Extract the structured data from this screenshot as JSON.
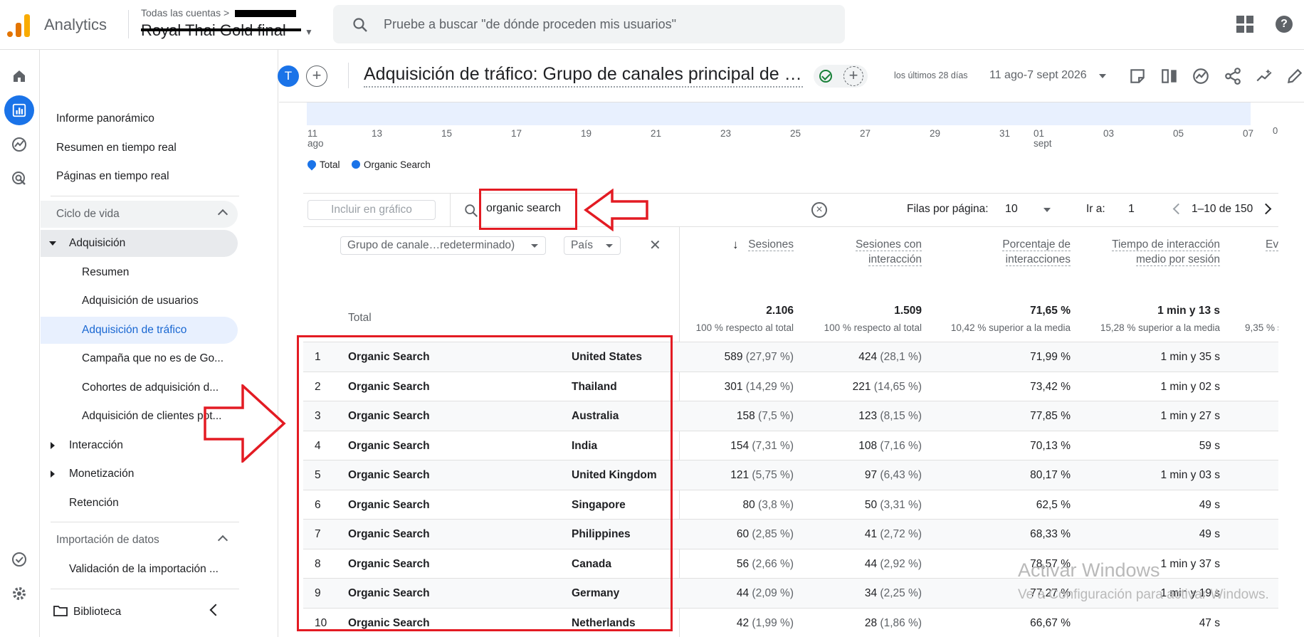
{
  "header": {
    "app_name": "Analytics",
    "accounts_label": "Todas las cuentas >",
    "property_name": "Royal Thai Gold final",
    "search_placeholder": "Pruebe a buscar \"de dónde proceden mis usuarios\""
  },
  "nav": {
    "items": [
      {
        "label": "Informe panorámico"
      },
      {
        "label": "Resumen en tiempo real"
      },
      {
        "label": "Páginas en tiempo real"
      },
      {
        "label": "Ciclo de vida"
      },
      {
        "label": "Adquisición"
      },
      {
        "label": "Resumen"
      },
      {
        "label": "Adquisición de usuarios"
      },
      {
        "label": "Adquisición de tráfico"
      },
      {
        "label": "Campaña que no es de Go..."
      },
      {
        "label": "Cohortes de adquisición d..."
      },
      {
        "label": "Adquisición de clientes pot..."
      },
      {
        "label": "Interacción"
      },
      {
        "label": "Monetización"
      },
      {
        "label": "Retención"
      },
      {
        "label": "Importación de datos"
      },
      {
        "label": "Validación de la importación ..."
      },
      {
        "label": "Biblioteca"
      }
    ]
  },
  "report": {
    "avatar_letter": "T",
    "title": "Adquisición de tráfico: Grupo de canales principal de la sesión (Grupo de canales predeterminado)",
    "date_label": "los últimos 28 días",
    "date_range": "11 ago-7 sept 2026"
  },
  "chart": {
    "x_ticks": [
      "11",
      "13",
      "15",
      "17",
      "19",
      "21",
      "23",
      "25",
      "27",
      "29",
      "31",
      "01",
      "03",
      "05",
      "07"
    ],
    "x_sub_ago": "ago",
    "x_sub_sept": "sept",
    "y_zero": "0",
    "legend": [
      {
        "label": "Total",
        "color": "#1a73e8"
      },
      {
        "label": "Organic Search",
        "color": "#1a73e8"
      }
    ]
  },
  "table_toolbar": {
    "chart_button": "Incluir en gráfico",
    "search_value": "organic search",
    "rows_per_page_label": "Filas por página:",
    "rows_per_page_value": "10",
    "goto_label": "Ir a:",
    "goto_value": "1",
    "page_range": "1–10 de 150"
  },
  "table": {
    "dimension_1": "Grupo de canale…redeterminado)",
    "dimension_2": "País",
    "total_label": "Total",
    "columns": [
      {
        "line1": "Sesiones",
        "line2": ""
      },
      {
        "line1": "Sesiones con",
        "line2": "interacción"
      },
      {
        "line1": "Porcentaje de",
        "line2": "interacciones"
      },
      {
        "line1": "Tiempo de interacción",
        "line2": "medio por sesión"
      },
      {
        "line1": "Ev",
        "line2": ""
      }
    ],
    "totals": [
      {
        "value": "2.106",
        "sub": "100 % respecto al total"
      },
      {
        "value": "1.509",
        "sub": "100 % respecto al total"
      },
      {
        "value": "71,65 %",
        "sub": "10,42 % superior a la media"
      },
      {
        "value": "1 min y 13 s",
        "sub": "15,28 % superior a la media"
      },
      {
        "value": "",
        "sub": "9,35 % s"
      }
    ],
    "rows": [
      {
        "idx": "1",
        "channel": "Organic Search",
        "country": "United States",
        "sessions": "589",
        "sessions_pct": "(27,97 %)",
        "engaged": "424",
        "engaged_pct": "(28,1 %)",
        "rate": "71,99 %",
        "time": "1 min y 35 s"
      },
      {
        "idx": "2",
        "channel": "Organic Search",
        "country": "Thailand",
        "sessions": "301",
        "sessions_pct": "(14,29 %)",
        "engaged": "221",
        "engaged_pct": "(14,65 %)",
        "rate": "73,42 %",
        "time": "1 min y 02 s"
      },
      {
        "idx": "3",
        "channel": "Organic Search",
        "country": "Australia",
        "sessions": "158",
        "sessions_pct": "(7,5 %)",
        "engaged": "123",
        "engaged_pct": "(8,15 %)",
        "rate": "77,85 %",
        "time": "1 min y 27 s"
      },
      {
        "idx": "4",
        "channel": "Organic Search",
        "country": "India",
        "sessions": "154",
        "sessions_pct": "(7,31 %)",
        "engaged": "108",
        "engaged_pct": "(7,16 %)",
        "rate": "70,13 %",
        "time": "59 s"
      },
      {
        "idx": "5",
        "channel": "Organic Search",
        "country": "United Kingdom",
        "sessions": "121",
        "sessions_pct": "(5,75 %)",
        "engaged": "97",
        "engaged_pct": "(6,43 %)",
        "rate": "80,17 %",
        "time": "1 min y 03 s"
      },
      {
        "idx": "6",
        "channel": "Organic Search",
        "country": "Singapore",
        "sessions": "80",
        "sessions_pct": "(3,8 %)",
        "engaged": "50",
        "engaged_pct": "(3,31 %)",
        "rate": "62,5 %",
        "time": "49 s"
      },
      {
        "idx": "7",
        "channel": "Organic Search",
        "country": "Philippines",
        "sessions": "60",
        "sessions_pct": "(2,85 %)",
        "engaged": "41",
        "engaged_pct": "(2,72 %)",
        "rate": "68,33 %",
        "time": "49 s"
      },
      {
        "idx": "8",
        "channel": "Organic Search",
        "country": "Canada",
        "sessions": "56",
        "sessions_pct": "(2,66 %)",
        "engaged": "44",
        "engaged_pct": "(2,92 %)",
        "rate": "78,57 %",
        "time": "1 min y 37 s"
      },
      {
        "idx": "9",
        "channel": "Organic Search",
        "country": "Germany",
        "sessions": "44",
        "sessions_pct": "(2,09 %)",
        "engaged": "34",
        "engaged_pct": "(2,25 %)",
        "rate": "77,27 %",
        "time": "1 min y 19 s"
      },
      {
        "idx": "10",
        "channel": "Organic Search",
        "country": "Netherlands",
        "sessions": "42",
        "sessions_pct": "(1,99 %)",
        "engaged": "28",
        "engaged_pct": "(1,86 %)",
        "rate": "66,67 %",
        "time": "47 s"
      }
    ]
  },
  "watermark": {
    "line1": "Activar Windows",
    "line2": "Ve a Configuración para activar Windows."
  },
  "colors": {
    "accent": "#1a73e8",
    "annotation_red": "#e31b23"
  }
}
